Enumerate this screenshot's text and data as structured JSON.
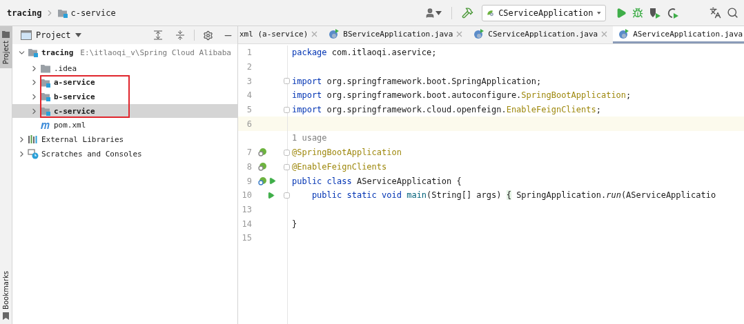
{
  "breadcrumb": [
    {
      "label": "tracing",
      "kind": "project"
    },
    {
      "label": "c-service",
      "kind": "module"
    }
  ],
  "toolbar": {
    "run_configuration": "CServiceApplication"
  },
  "left_strip": {
    "top": [
      {
        "label": "Project",
        "selected": true
      }
    ],
    "bottom": [
      {
        "label": "Bookmarks",
        "selected": false
      }
    ]
  },
  "project_panel": {
    "title": "Project",
    "tree": [
      {
        "label": "tracing",
        "kind": "module",
        "hint": "E:\\itlaoqi_v\\Spring Cloud Alibaba",
        "expanded": true,
        "selected": false,
        "marked": false,
        "children": [
          {
            "label": ".idea",
            "kind": "folder",
            "expanded": false,
            "selected": false,
            "marked": false
          },
          {
            "label": "a-service",
            "kind": "module",
            "expanded": false,
            "selected": false,
            "marked": true
          },
          {
            "label": "b-service",
            "kind": "module",
            "expanded": false,
            "selected": false,
            "marked": true
          },
          {
            "label": "c-service",
            "kind": "module",
            "expanded": false,
            "selected": true,
            "marked": true
          },
          {
            "label": "pom.xml",
            "kind": "maven",
            "selected": false,
            "marked": false
          }
        ]
      },
      {
        "label": "External Libraries",
        "kind": "libraries",
        "expanded": false,
        "selected": false,
        "marked": false
      },
      {
        "label": "Scratches and Consoles",
        "kind": "scratches",
        "expanded": false,
        "selected": false,
        "marked": false
      }
    ]
  },
  "editor": {
    "tabs": [
      {
        "label": "xml (a-service)",
        "selected": false
      },
      {
        "label": "BServiceApplication.java",
        "kind": "spring",
        "selected": false
      },
      {
        "label": "CServiceApplication.java",
        "kind": "spring",
        "selected": false
      },
      {
        "label": "AServiceApplication.java",
        "kind": "spring",
        "selected": true
      }
    ],
    "lines": [
      {
        "kind": "code",
        "number": "1",
        "fold": false,
        "current": false,
        "bean_marker": false,
        "run_marker": false,
        "tokens": [
          {
            "text": "package",
            "kind": "keyword"
          },
          {
            "text": " com.itlaoqi.aservice;",
            "kind": "plain"
          }
        ]
      },
      {
        "kind": "code",
        "number": "2",
        "fold": false,
        "current": false,
        "bean_marker": false,
        "run_marker": false
      },
      {
        "kind": "code",
        "number": "3",
        "fold": true,
        "current": false,
        "bean_marker": false,
        "run_marker": false,
        "tokens": [
          {
            "text": "import",
            "kind": "keyword"
          },
          {
            "text": " org.springframework.boot.SpringApplication;",
            "kind": "plain"
          }
        ]
      },
      {
        "kind": "code",
        "number": "4",
        "fold": false,
        "current": false,
        "bean_marker": false,
        "run_marker": false,
        "tokens": [
          {
            "text": "import",
            "kind": "keyword"
          },
          {
            "text": " org.springframework.boot.autoconfigure.",
            "kind": "plain"
          },
          {
            "text": "SpringBootApplication",
            "kind": "annotation"
          },
          {
            "text": ";",
            "kind": "plain"
          }
        ]
      },
      {
        "kind": "code",
        "number": "5",
        "fold": true,
        "current": false,
        "bean_marker": false,
        "run_marker": false,
        "tokens": [
          {
            "text": "import",
            "kind": "keyword"
          },
          {
            "text": " org.springframework.cloud.openfeign.",
            "kind": "plain"
          },
          {
            "text": "EnableFeignClients",
            "kind": "annotation"
          },
          {
            "text": ";",
            "kind": "plain"
          }
        ]
      },
      {
        "kind": "code",
        "number": "6",
        "fold": false,
        "current": true,
        "bean_marker": false,
        "run_marker": false
      },
      {
        "kind": "hint",
        "text": "1 usage"
      },
      {
        "kind": "code",
        "number": "7",
        "fold": true,
        "current": false,
        "bean_marker": true,
        "run_marker": false,
        "tokens": [
          {
            "text": "@SpringBootApplication",
            "kind": "annotation"
          }
        ]
      },
      {
        "kind": "code",
        "number": "8",
        "fold": true,
        "current": false,
        "bean_marker": true,
        "run_marker": false,
        "tokens": [
          {
            "text": "@EnableFeignClients",
            "kind": "annotation"
          }
        ]
      },
      {
        "kind": "code",
        "number": "9",
        "fold": false,
        "current": false,
        "bean_marker": true,
        "run_marker": true,
        "tokens": [
          {
            "text": "public class",
            "kind": "keyword"
          },
          {
            "text": " AServiceApplication {",
            "kind": "plain"
          }
        ]
      },
      {
        "kind": "code",
        "number": "10",
        "fold": true,
        "current": false,
        "bean_marker": false,
        "run_marker": true,
        "tokens": [
          {
            "text": "    public static void",
            "kind": "keyword"
          },
          {
            "text": " main",
            "kind": "method"
          },
          {
            "text": "(String[] args) ",
            "kind": "plain"
          },
          {
            "text": "{",
            "kind": "folded"
          },
          {
            "text": " SpringApplication.",
            "kind": "plain"
          },
          {
            "text": "run",
            "kind": "static"
          },
          {
            "text": "(AServiceApplicatio",
            "kind": "plain"
          }
        ]
      },
      {
        "kind": "code",
        "number": "13",
        "fold": false,
        "current": false,
        "bean_marker": false,
        "run_marker": false
      },
      {
        "kind": "code",
        "number": "14",
        "fold": false,
        "current": false,
        "bean_marker": false,
        "run_marker": false,
        "tokens": [
          {
            "text": "}",
            "kind": "plain"
          }
        ]
      },
      {
        "kind": "code",
        "number": "15",
        "fold": false,
        "current": false,
        "bean_marker": false,
        "run_marker": false
      }
    ]
  }
}
